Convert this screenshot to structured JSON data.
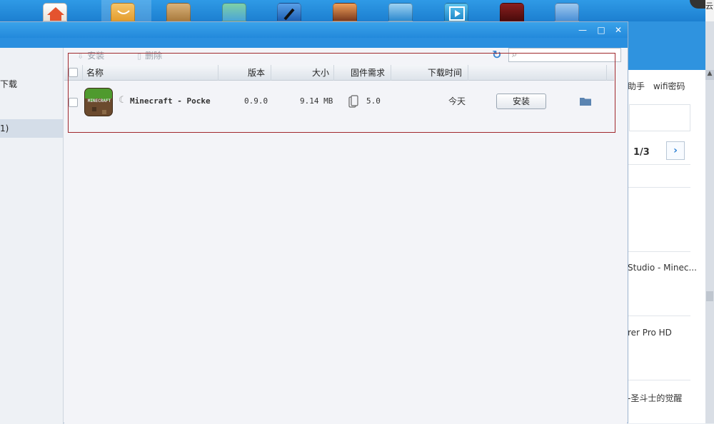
{
  "toolbar": {
    "icons": [
      "home-icon",
      "app-store-icon",
      "ebook-icon",
      "games-icon",
      "ringtone-icon",
      "wallpaper-icon",
      "flashlight-icon",
      "video-icon",
      "book-icon",
      "tools-icon"
    ]
  },
  "background_window": {
    "links": [
      "助手",
      "wifi密码"
    ],
    "pager": "1/3",
    "items": [
      "Studio - Minec...",
      "rer Pro HD",
      "-圣斗士的觉醒"
    ],
    "top_right_text": "云"
  },
  "downloads_window": {
    "sidebar": {
      "items": [
        {
          "label": "下载",
          "selected": false
        },
        {
          "label": "1)",
          "selected": true
        }
      ]
    },
    "actions": {
      "install_label": "安装",
      "delete_label": "删除"
    },
    "search": {
      "value": "",
      "placeholder": ""
    },
    "columns": {
      "name": "名称",
      "version": "版本",
      "size": "大小",
      "firmware": "固件需求",
      "download_time": "下载时间"
    },
    "rows": [
      {
        "name": "Minecraft - Pocke",
        "version": "0.9.0",
        "size": "9.14 MB",
        "firmware": "5.0",
        "time": "今天",
        "button_label": "安装",
        "icon_text": "MINECRAFT"
      }
    ]
  },
  "colors": {
    "toolbar_blue": "#2389db",
    "highlight_border": "#a0282d"
  }
}
